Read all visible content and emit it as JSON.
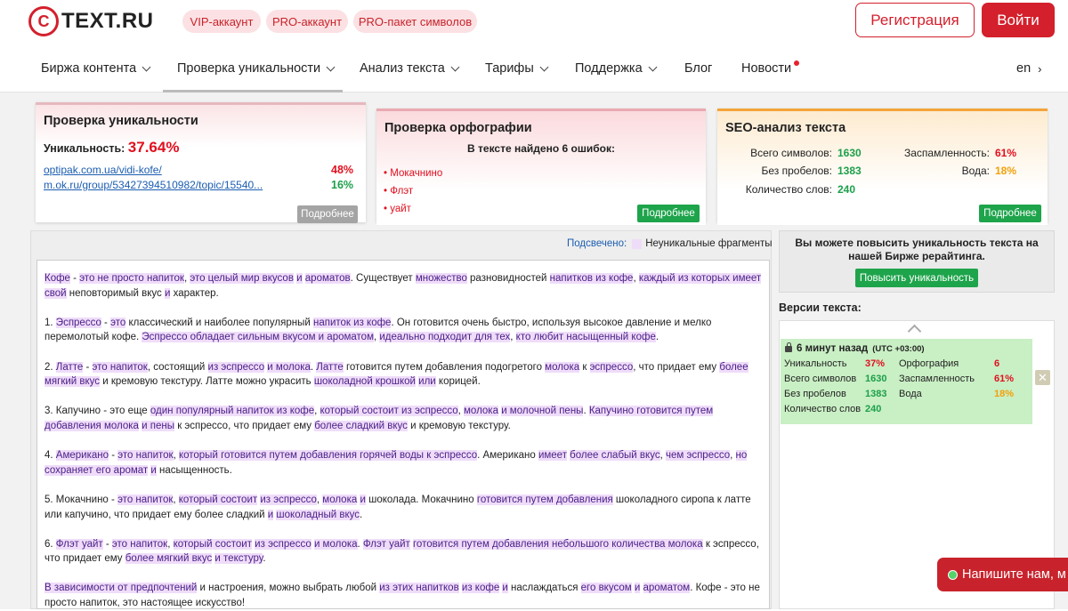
{
  "header": {
    "logo_mark": "C",
    "logo_text": "TEXT.RU",
    "pills": [
      "VIP-аккаунт",
      "PRO-аккаунт",
      "PRO-пакет символов"
    ],
    "register_label": "Регистрация",
    "login_label": "Войти"
  },
  "nav": {
    "items": [
      "Биржа контента",
      "Проверка уникальности",
      "Анализ текста",
      "Тарифы",
      "Поддержка",
      "Блог",
      "Новости"
    ],
    "lang": "en"
  },
  "uniqueness": {
    "title": "Проверка уникальности",
    "label": "Уникальность:",
    "value": "37.64%",
    "sources": [
      {
        "url": "optipak.com.ua/vidi-kofe/",
        "pct": "48%"
      },
      {
        "url": "m.ok.ru/group/53427394510982/topic/15540...",
        "pct": "16%"
      }
    ],
    "more_label": "Подробнее"
  },
  "spelling": {
    "title": "Проверка орфографии",
    "summary": "В тексте найдено 6 ошибок:",
    "errors": [
      "Мокачнино",
      "Флэт",
      "уайт"
    ],
    "more_label": "Подробнее"
  },
  "seo": {
    "title": "SEO-анализ текста",
    "total_chars_label": "Всего символов:",
    "total_chars": "1630",
    "no_spaces_label": "Без пробелов:",
    "no_spaces": "1383",
    "words_label": "Количество слов:",
    "words": "240",
    "spam_label": "Заспамленность:",
    "spam": "61%",
    "water_label": "Вода:",
    "water": "18%",
    "more_label": "Подробнее"
  },
  "highlight": {
    "label": "Подсвечено:",
    "legend": "Неуникальные фрагменты"
  },
  "promo": {
    "text": "Вы можете повысить уникальность текста на нашей Бирже рерайтинга.",
    "button": "Повысить уникальность"
  },
  "versions": {
    "title": "Версии текста:",
    "item": {
      "time": "6 минут назад",
      "tz": "(UTC +03:00)",
      "uniq_label": "Уникальность",
      "uniq": "37%",
      "ortho_label": "Орфография",
      "ortho": "6",
      "chars_label": "Всего символов",
      "chars": "1630",
      "spam_label": "Заспамленность",
      "spam": "61%",
      "nosp_label": "Без пробелов",
      "nosp": "1383",
      "water_label": "Вода",
      "water": "18%",
      "words_label": "Количество слов",
      "words": "240"
    }
  },
  "chat": {
    "label": "Напишите нам, м"
  },
  "colors": {
    "brand": "#d3202c",
    "green": "#1ea44b",
    "highlight": "#efdcf9"
  }
}
